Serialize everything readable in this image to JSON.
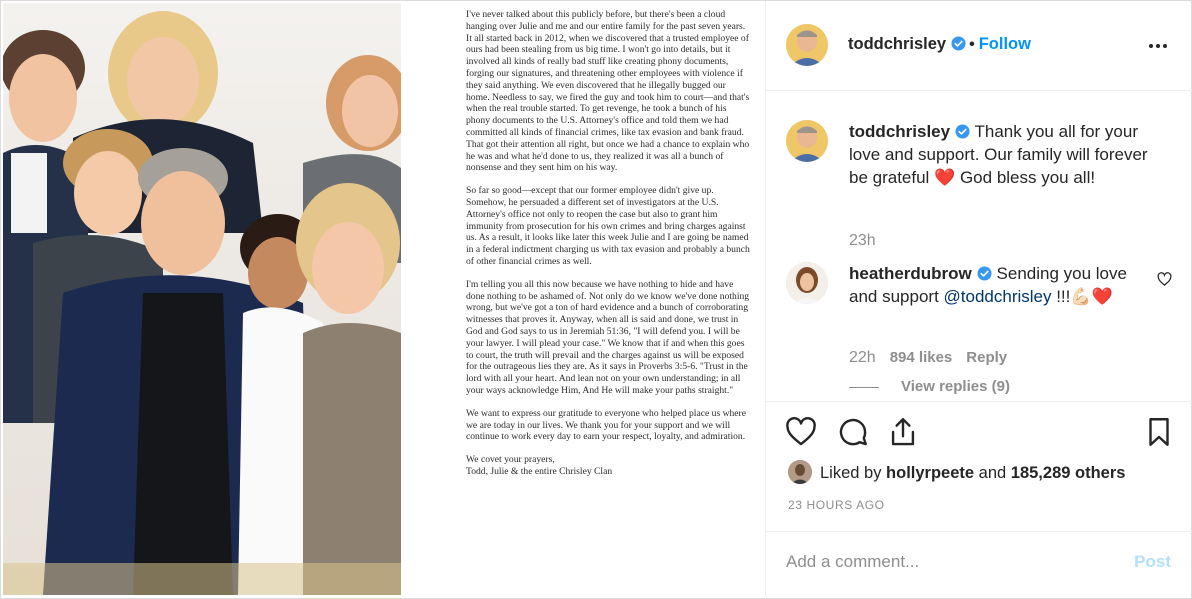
{
  "photo": {
    "alt_name": "chrisley-family-photo"
  },
  "letter": {
    "paragraphs": [
      "I've never talked about this publicly before, but there's been a cloud hanging over Julie and me and our entire family for the past seven years. It all started back in 2012, when we discovered that a trusted employee of ours had been stealing from us big time. I won't go into details, but it involved all kinds of really bad stuff like creating phony documents, forging our signatures, and threatening other employees with violence if they said anything. We even discovered that he illegally bugged our home. Needless to say, we fired the guy and took him to court—and that's when the real trouble started. To get revenge, he took a bunch of his phony documents to the U.S. Attorney's office and told them we had committed all kinds of financial crimes, like tax evasion and bank fraud. That got their attention all right, but once we had a chance to explain who he was and what he'd done to us, they realized it was all a bunch of nonsense and they sent him on his way.",
      "So far so good—except that our former employee didn't give up. Somehow, he persuaded a different set of investigators at the U.S. Attorney's office not only to reopen the case but also to grant him immunity from prosecution for his own crimes and bring charges against us. As a result, it looks like later this week Julie and I are going be named in a federal indictment charging us with tax evasion and probably a bunch of other financial crimes as well.",
      "I'm telling you all this now because we have nothing to hide and have done nothing to be ashamed of. Not only do we know we've done nothing wrong, but we've got a ton of hard evidence and a bunch of corroborating witnesses that proves it. Anyway, when all is said and done, we trust in God and God says to us in Jeremiah 51:36, \"I will defend you. I will be your lawyer. I will plead your case.\" We know that if and when this goes to court, the truth will prevail and the charges against us will be exposed for the outrageous lies they are. As it says in Proverbs 3:5-6. \"Trust in the lord with all your heart. And lean not on your own understanding; in all your ways acknowledge Him, And He will make your paths straight.\"",
      "We want to express our gratitude to everyone who helped place us where we are today in our lives. We thank you for your support and we will continue to work every day to earn your respect, loyalty, and admiration.",
      "We covet your prayers,\nTodd, Julie & the entire Chrisley Clan"
    ]
  },
  "header": {
    "username": "toddchrisley",
    "separator": "•",
    "follow_label": "Follow"
  },
  "comments": [
    {
      "username": "toddchrisley",
      "text_before": " Thank you all for your love and support. Our family will forever be grateful ",
      "emoji": "❤️",
      "text_after": " God bless you all!",
      "time": "23h"
    },
    {
      "username": "heatherdubrow",
      "text_before": " Sending you love and support ",
      "mention": "@toddchrisley",
      "text_after": " !!!💪🏻❤️",
      "time": "22h",
      "likes": "894 likes",
      "reply": "Reply",
      "view_replies": "View replies (9)"
    }
  ],
  "actions": {
    "liked_by_prefix": "Liked by ",
    "liked_by_user": "hollyrpeete",
    "liked_by_middle": " and ",
    "liked_by_count": "185,289 others",
    "timestamp": "23 HOURS AGO"
  },
  "add_comment": {
    "placeholder": "Add a comment...",
    "post_label": "Post"
  },
  "colors": {
    "link_blue": "#0095f6",
    "verified_blue": "#3897f0",
    "heart_red": "#ed4956",
    "muted": "#8e8e8e"
  }
}
